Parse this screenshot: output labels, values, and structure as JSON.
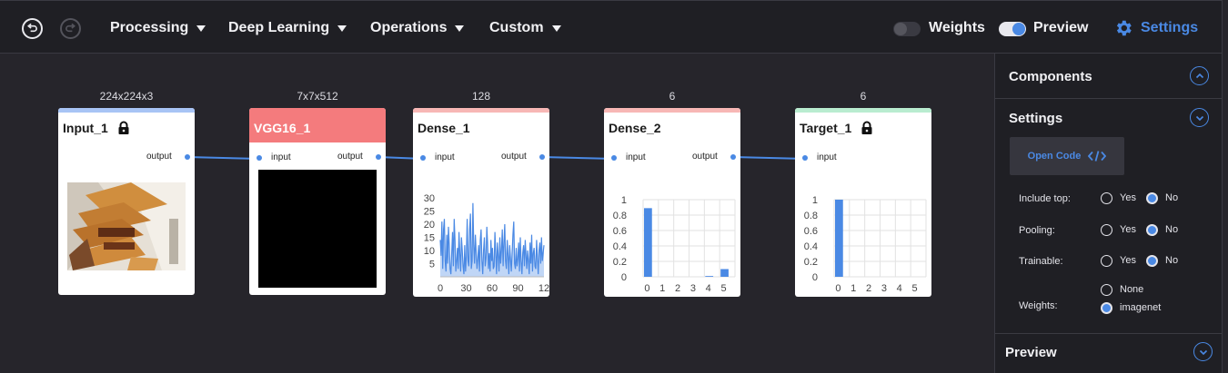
{
  "toolbar": {
    "undo_icon": "undo-icon",
    "redo_icon": "redo-icon",
    "menus": [
      {
        "label": "Processing"
      },
      {
        "label": "Deep Learning"
      },
      {
        "label": "Operations"
      },
      {
        "label": "Custom"
      }
    ],
    "weights_label": "Weights",
    "weights_on": false,
    "preview_label": "Preview",
    "preview_on": true,
    "settings_label": "Settings",
    "accent": "#4a89e4"
  },
  "nodes": [
    {
      "name": "Input_1",
      "shape": "224x224x3",
      "color": "#a8c4f5",
      "locked": true,
      "ports": {
        "output": "output"
      }
    },
    {
      "name": "VGG16_1",
      "shape": "7x7x512",
      "color": "#f47b7d",
      "ports": {
        "input": "input",
        "output": "output"
      }
    },
    {
      "name": "Dense_1",
      "shape": "128",
      "color": "#f7b7b5",
      "ports": {
        "input": "input",
        "output": "output"
      }
    },
    {
      "name": "Dense_2",
      "shape": "6",
      "color": "#f7b7b5",
      "ports": {
        "input": "input",
        "output": "output"
      }
    },
    {
      "name": "Target_1",
      "shape": "6",
      "color": "#b9ecd0",
      "locked": true,
      "ports": {
        "input": "input"
      }
    }
  ],
  "chart_data": [
    {
      "type": "area",
      "node": "Dense_1",
      "x_ticks": [
        "0",
        "30",
        "60",
        "90",
        "12"
      ],
      "y_ticks": [
        "5",
        "10",
        "15",
        "20",
        "25",
        "30"
      ],
      "ylim": [
        0,
        30
      ],
      "color": "#4a89e4",
      "values": [
        14,
        8,
        21,
        3,
        18,
        22,
        6,
        2,
        16,
        5,
        19,
        12,
        3,
        1,
        9,
        17,
        4,
        22,
        14,
        2,
        6,
        11,
        3,
        17,
        9,
        2,
        15,
        10,
        4,
        1,
        12,
        2,
        8,
        22,
        6,
        4,
        18,
        24,
        3,
        6,
        28,
        12,
        5,
        16,
        9,
        3,
        7,
        12,
        2,
        14,
        18,
        6,
        1,
        10,
        15,
        4,
        7,
        19,
        12,
        3,
        9,
        2,
        14,
        6,
        11,
        3,
        4,
        17,
        9,
        1,
        13,
        8,
        2,
        15,
        5,
        10,
        18,
        4,
        13,
        20,
        6,
        3,
        14,
        8,
        1,
        12,
        7,
        2,
        9,
        16,
        21,
        5,
        3,
        11,
        4,
        7,
        13,
        2,
        15,
        6,
        1,
        9,
        12,
        4,
        14,
        8,
        3,
        10,
        6,
        1,
        13,
        5,
        16,
        2,
        9,
        11,
        4,
        3,
        14,
        7,
        1,
        10,
        13,
        5,
        15,
        6,
        9,
        12
      ]
    },
    {
      "type": "bar",
      "node": "Dense_2",
      "categories": [
        "0",
        "1",
        "2",
        "3",
        "4",
        "5"
      ],
      "values": [
        0.89,
        0,
        0,
        0,
        0.01,
        0.1
      ],
      "y_ticks": [
        "0",
        "0.2",
        "0.4",
        "0.6",
        "0.8",
        "1"
      ],
      "ylim": [
        0,
        1
      ],
      "color": "#4a89e4"
    },
    {
      "type": "bar",
      "node": "Target_1",
      "categories": [
        "0",
        "1",
        "2",
        "3",
        "4",
        "5"
      ],
      "values": [
        1,
        0,
        0,
        0,
        0,
        0
      ],
      "y_ticks": [
        "0",
        "0.2",
        "0.4",
        "0.6",
        "0.8",
        "1"
      ],
      "ylim": [
        0,
        1
      ],
      "color": "#4a89e4"
    }
  ],
  "panel": {
    "components_label": "Components",
    "settings_label": "Settings",
    "open_code_label": "Open Code",
    "options": [
      {
        "label": "Include top:",
        "choices": [
          "Yes",
          "No"
        ],
        "selected": "No"
      },
      {
        "label": "Pooling:",
        "choices": [
          "Yes",
          "No"
        ],
        "selected": "No"
      },
      {
        "label": "Trainable:",
        "choices": [
          "Yes",
          "No"
        ],
        "selected": "No"
      },
      {
        "label": "Weights:",
        "choices": [
          "None",
          "imagenet"
        ],
        "selected": "imagenet"
      }
    ],
    "preview_label": "Preview"
  }
}
